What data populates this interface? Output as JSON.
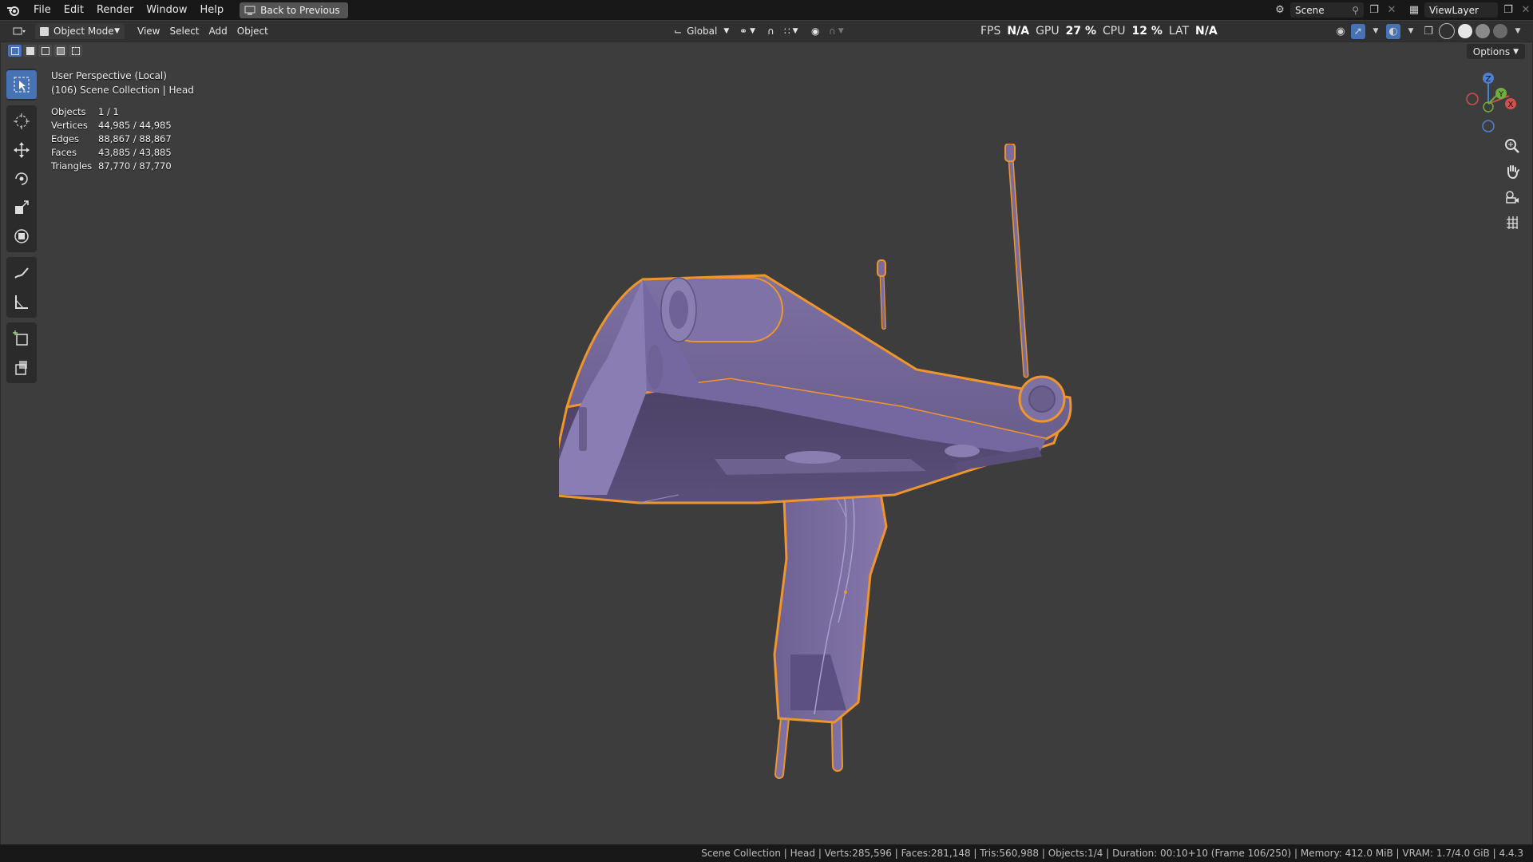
{
  "menu": {
    "items": [
      "File",
      "Edit",
      "Render",
      "Window",
      "Help"
    ],
    "back_button": "Back to Previous"
  },
  "scene": {
    "name": "Scene",
    "view_layer": "ViewLayer"
  },
  "viewport_header": {
    "mode": "Object Mode",
    "menus": [
      "View",
      "Select",
      "Add",
      "Object"
    ],
    "orientation": "Global",
    "options_label": "Options"
  },
  "perf": {
    "fps_label": "FPS",
    "fps_value": "N/A",
    "gpu_label": "GPU",
    "gpu_value": "27 %",
    "cpu_label": "CPU",
    "cpu_value": "12 %",
    "lat_label": "LAT",
    "lat_value": "N/A"
  },
  "overlay": {
    "perspective": "User Perspective (Local)",
    "collection": "(106) Scene Collection | Head",
    "stats": [
      {
        "label": "Objects",
        "value": "1 / 1"
      },
      {
        "label": "Vertices",
        "value": "44,985 / 44,985"
      },
      {
        "label": "Edges",
        "value": "88,867 / 88,867"
      },
      {
        "label": "Faces",
        "value": "43,885 / 43,885"
      },
      {
        "label": "Triangles",
        "value": "87,770 / 87,770"
      }
    ]
  },
  "gizmo": {
    "x": "X",
    "y": "Y",
    "z": "Z"
  },
  "status_bar": "Scene Collection | Head | Verts:285,596 | Faces:281,148 | Tris:560,988 | Objects:1/4 | Duration: 00:10+10 (Frame 106/250) | Memory: 412.0 MiB | VRAM: 1.7/4.0 GiB | 4.4.3",
  "colors": {
    "model_fill": "#7b6e9e",
    "model_outline": "#f0952c",
    "active_tool": "#4772b3",
    "viewport_bg": "#3d3d3d"
  },
  "icons": [
    "blender-logo",
    "select-box-icon",
    "cursor-icon",
    "move-icon",
    "rotate-icon",
    "scale-icon",
    "transform-icon",
    "annotate-icon",
    "measure-icon",
    "add-cube-icon",
    "extrude-icon",
    "zoom-icon",
    "pan-hand-icon",
    "camera-icon",
    "grid-icon"
  ]
}
